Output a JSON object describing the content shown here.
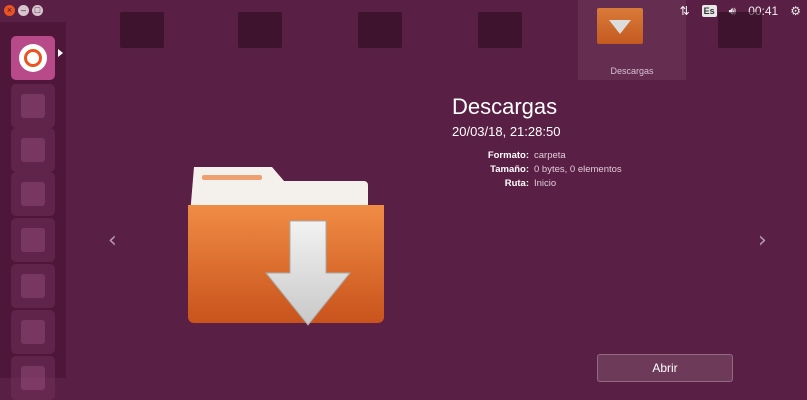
{
  "panel": {
    "keyboard_layout": "Es",
    "time": "00:41",
    "icons": [
      "network-icon",
      "keyboard-icon",
      "volume-icon",
      "settings-icon"
    ]
  },
  "launcher": {
    "items": [
      "dash-home",
      "files",
      "firefox",
      "writer",
      "calc",
      "impress",
      "software-center",
      "amazon"
    ]
  },
  "carousel": {
    "active_label": "Descargas"
  },
  "preview": {
    "title": "Descargas",
    "subtitle": "20/03/18, 21:28:50",
    "fields": [
      {
        "label": "Formato:",
        "value": "carpeta"
      },
      {
        "label": "Tamaño:",
        "value": "0 bytes, 0 elementos"
      },
      {
        "label": "Ruta:",
        "value": "Inicio"
      }
    ],
    "open_label": "Abrir"
  },
  "colors": {
    "background": "#5a1f44",
    "accent": "#e95420",
    "folder": "#e0793a"
  }
}
